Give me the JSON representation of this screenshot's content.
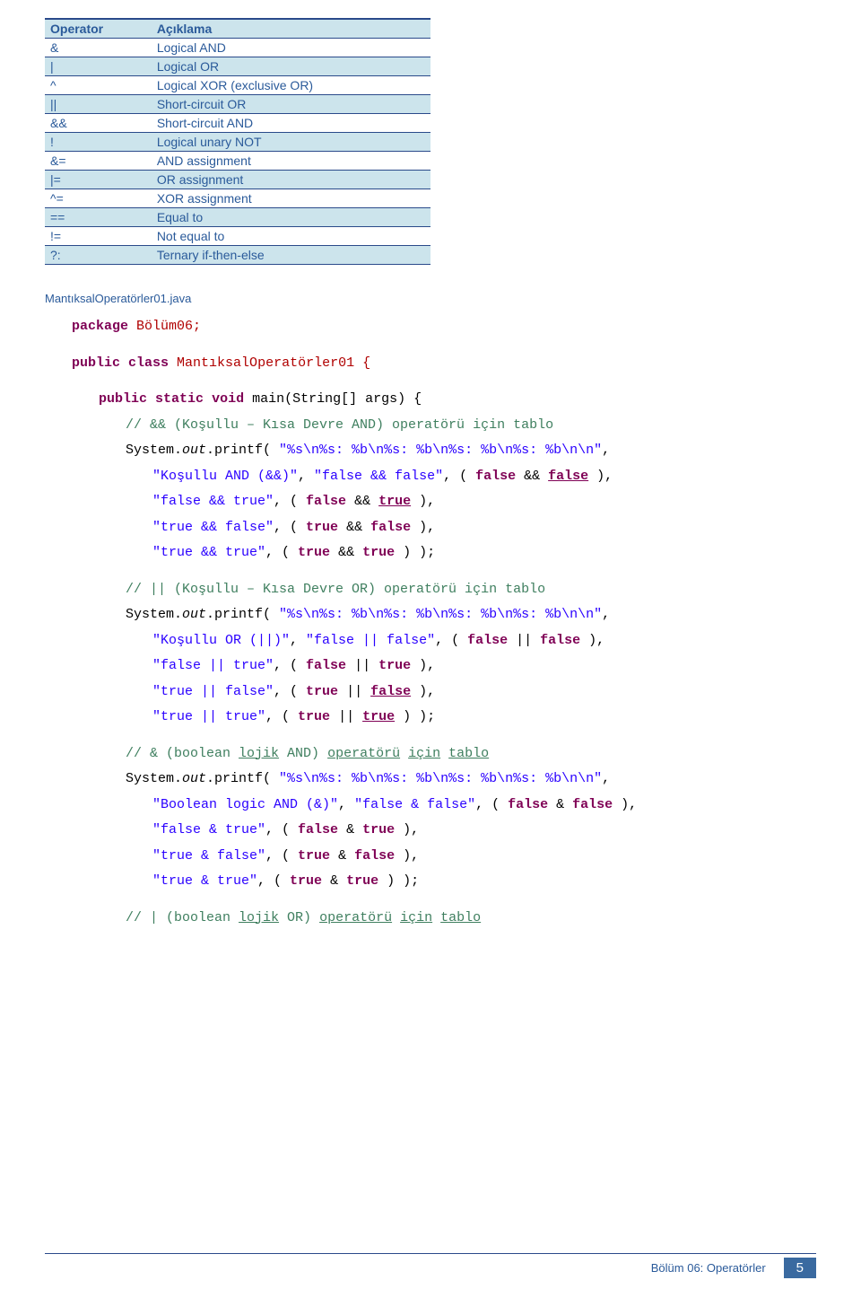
{
  "table": {
    "headers": [
      "Operator",
      "Açıklama"
    ],
    "rows": [
      [
        "&",
        "Logical AND"
      ],
      [
        "|",
        "Logical OR"
      ],
      [
        "^",
        "Logical XOR (exclusive OR)"
      ],
      [
        "||",
        "Short-circuit OR"
      ],
      [
        "&&",
        "Short-circuit AND"
      ],
      [
        "!",
        "Logical unary NOT"
      ],
      [
        "&=",
        "AND assignment"
      ],
      [
        "|=",
        "OR assignment"
      ],
      [
        "^=",
        "XOR assignment"
      ],
      [
        "==",
        "Equal to"
      ],
      [
        "!=",
        "Not equal to"
      ],
      [
        "?:",
        "Ternary if-then-else"
      ]
    ]
  },
  "file_heading": "MantıksalOperatörler01.java",
  "code": {
    "kw_package": "package",
    "pkg_name": " Bölüm06;",
    "kw_public": "public",
    "kw_class": "class",
    "class_name": " MantıksalOperatörler01 {",
    "kw_static": "static",
    "kw_void": "void",
    "method_sig": " main(String[] args) {",
    "cm1": "// && (Koşullu – Kısa Devre AND) operatörü için tablo",
    "sys": "System.",
    "out": "out",
    "printf_open": ".printf( ",
    "fmt": "\"%s\\n%s: %b\\n%s: %b\\n%s: %b\\n%s: %b\\n\\n\"",
    "and_label": "\"Koşullu AND (&&)\"",
    "ff": "\"false && false\"",
    "ft": "\"false && true\"",
    "tf": "\"true && false\"",
    "tt": "\"true && true\"",
    "kw_false": "false",
    "kw_true": "true",
    "cm2": "// || (Koşullu – Kısa Devre OR) operatörü için tablo",
    "or_label": "\"Koşullu OR (||)\"",
    "off": "\"false || false\"",
    "oft": "\"false || true\"",
    "otf": "\"true || false\"",
    "ott": "\"true || true\"",
    "cm3a": "// & (boolean ",
    "cm3b": "lojik",
    "cm3c": " AND) ",
    "cm3d": "operatörü",
    "cm3e": "için",
    "cm3f": "tablo",
    "band_label": "\"Boolean logic AND (&)\"",
    "bff": "\"false & false\"",
    "bft": "\"false & true\"",
    "btf": "\"true & false\"",
    "btt": "\"true & true\"",
    "cm4a": "// | (boolean ",
    "footer_text": "Bölüm 06: Operatörler",
    "page_num": "5"
  }
}
